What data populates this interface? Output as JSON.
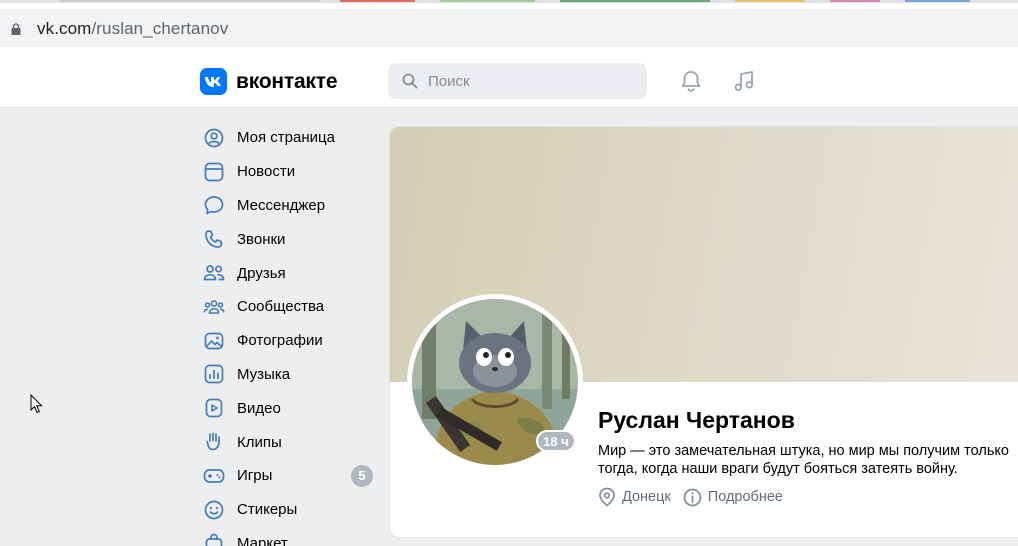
{
  "browser": {
    "url_domain": "vk.com",
    "url_path": "/ruslan_chertanov"
  },
  "header": {
    "logo_text": "вконтакте",
    "search_placeholder": "Поиск"
  },
  "menu": {
    "items": [
      {
        "label": "Моя страница",
        "icon": "user-circle-icon"
      },
      {
        "label": "Новости",
        "icon": "newsfeed-icon"
      },
      {
        "label": "Мессенджер",
        "icon": "message-icon"
      },
      {
        "label": "Звонки",
        "icon": "phone-icon"
      },
      {
        "label": "Друзья",
        "icon": "friends-icon"
      },
      {
        "label": "Сообщества",
        "icon": "communities-icon"
      },
      {
        "label": "Фотографии",
        "icon": "photo-icon"
      },
      {
        "label": "Музыка",
        "icon": "music-icon"
      },
      {
        "label": "Видео",
        "icon": "video-icon"
      },
      {
        "label": "Клипы",
        "icon": "clips-icon"
      },
      {
        "label": "Игры",
        "icon": "gamepad-icon",
        "badge": "5"
      },
      {
        "label": "Стикеры",
        "icon": "smile-icon"
      },
      {
        "label": "Маркет",
        "icon": "market-icon"
      }
    ]
  },
  "profile": {
    "name": "Руслан Чертанов",
    "status": "Мир — это замечательная штука, но мир мы получим только тогда, когда наши враги будут бояться затеять войну.",
    "online_badge": "18 ч",
    "city": "Донецк",
    "more_link": "Подробнее"
  },
  "colors": {
    "vk_blue": "#0077ff",
    "menu_icon": "#447bba",
    "page_bg": "#edeef0",
    "badge_gray": "#aeb7c2"
  }
}
